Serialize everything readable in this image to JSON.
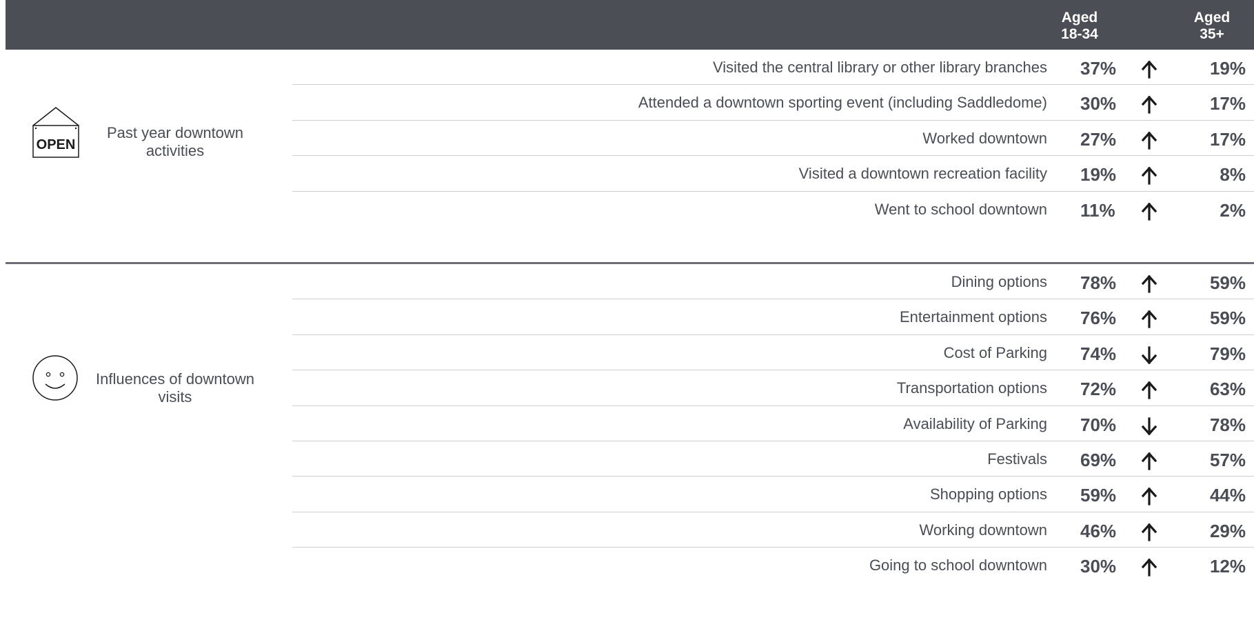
{
  "chart_data": {
    "type": "table",
    "columns": [
      "Aged 18-34",
      "Aged 35+"
    ],
    "sections": [
      {
        "label": "Past year downtown activities",
        "icon": "open-sign-icon",
        "rows": [
          {
            "label": "Visited the central library or other library branches",
            "aged_18_34": "37%",
            "trend": "up",
            "aged_35_plus": "19%"
          },
          {
            "label": "Attended a downtown sporting event (including Saddledome)",
            "aged_18_34": "30%",
            "trend": "up",
            "aged_35_plus": "17%"
          },
          {
            "label": "Worked downtown",
            "aged_18_34": "27%",
            "trend": "up",
            "aged_35_plus": "17%"
          },
          {
            "label": "Visited a downtown recreation facility",
            "aged_18_34": "19%",
            "trend": "up",
            "aged_35_plus": "8%"
          },
          {
            "label": "Went to school downtown",
            "aged_18_34": "11%",
            "trend": "up",
            "aged_35_plus": "2%"
          }
        ]
      },
      {
        "label": "Influences of downtown visits",
        "icon": "smiley-face-icon",
        "rows": [
          {
            "label": "Dining options",
            "aged_18_34": "78%",
            "trend": "up",
            "aged_35_plus": "59%"
          },
          {
            "label": "Entertainment options",
            "aged_18_34": "76%",
            "trend": "up",
            "aged_35_plus": "59%"
          },
          {
            "label": "Cost of Parking",
            "aged_18_34": "74%",
            "trend": "down",
            "aged_35_plus": "79%"
          },
          {
            "label": "Transportation options",
            "aged_18_34": "72%",
            "trend": "up",
            "aged_35_plus": "63%"
          },
          {
            "label": "Availability of Parking",
            "aged_18_34": "70%",
            "trend": "down",
            "aged_35_plus": "78%"
          },
          {
            "label": "Festivals",
            "aged_18_34": "69%",
            "trend": "up",
            "aged_35_plus": "57%"
          },
          {
            "label": "Shopping options",
            "aged_18_34": "59%",
            "trend": "up",
            "aged_35_plus": "44%"
          },
          {
            "label": "Working downtown",
            "aged_18_34": "46%",
            "trend": "up",
            "aged_35_plus": "29%"
          },
          {
            "label": "Going to school downtown",
            "aged_18_34": "30%",
            "trend": "up",
            "aged_35_plus": "12%"
          }
        ]
      }
    ]
  },
  "header": {
    "col1_line1": "Aged",
    "col1_line2": "18-34",
    "col2_line1": "Aged",
    "col2_line2": "35+"
  },
  "icons": {
    "open_sign_text": "OPEN"
  },
  "colors": {
    "header_bg": "#4b4e55",
    "text": "#4a4d55",
    "arrow": "#1a1a1a"
  }
}
